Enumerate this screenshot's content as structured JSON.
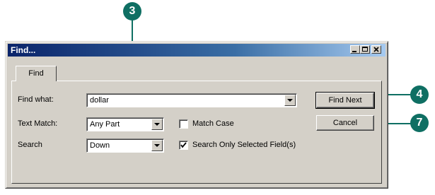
{
  "window": {
    "title": "Find..."
  },
  "tabs": [
    {
      "label": "Find"
    }
  ],
  "fields": {
    "find_what": {
      "label": "Find what:",
      "value": "dollar"
    },
    "text_match": {
      "label": "Text Match:",
      "value": "Any Part"
    },
    "search": {
      "label": "Search",
      "value": "Down"
    }
  },
  "checkboxes": {
    "match_case": {
      "label": "Match Case",
      "checked": false
    },
    "search_selected": {
      "label": "Search Only Selected Field(s)",
      "checked": true
    }
  },
  "buttons": {
    "find_next": "Find Next",
    "cancel": "Cancel"
  },
  "callouts": {
    "find_what": "3",
    "find_next": "4",
    "cancel": "7"
  },
  "colors": {
    "callout": "#0f6f63",
    "titlebar": "#0a246a",
    "face": "#d4d0c8"
  }
}
